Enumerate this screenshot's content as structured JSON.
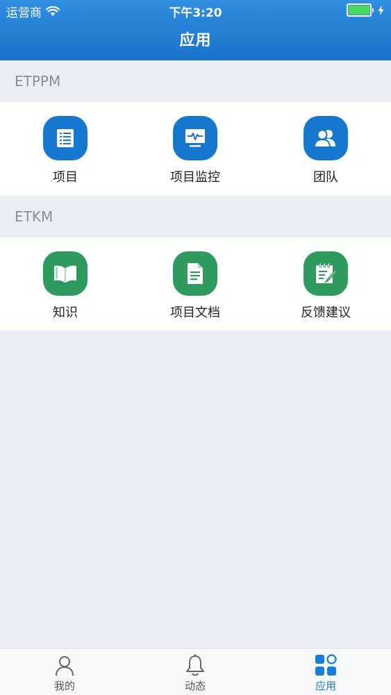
{
  "status_bar": {
    "carrier": "运营商",
    "time": "下午3:20"
  },
  "nav": {
    "title": "应用"
  },
  "sections": [
    {
      "label": "ETPPM",
      "apps": [
        {
          "label": "项目",
          "icon": "document-list-icon",
          "color": "#1677cf"
        },
        {
          "label": "项目监控",
          "icon": "monitor-pulse-icon",
          "color": "#1677cf"
        },
        {
          "label": "团队",
          "icon": "team-icon",
          "color": "#1677cf"
        }
      ]
    },
    {
      "label": "ETKM",
      "apps": [
        {
          "label": "知识",
          "icon": "open-book-icon",
          "color": "#2e9a5f"
        },
        {
          "label": "项目文档",
          "icon": "document-icon",
          "color": "#2e9a5f"
        },
        {
          "label": "反馈建议",
          "icon": "feedback-note-icon",
          "color": "#2e9a5f"
        }
      ]
    }
  ],
  "tabbar": {
    "items": [
      {
        "label": "我的",
        "icon": "person-icon",
        "active": false
      },
      {
        "label": "动态",
        "icon": "bell-icon",
        "active": false
      },
      {
        "label": "应用",
        "icon": "apps-grid-icon",
        "active": true
      }
    ],
    "active_color": "#1a7ed6"
  }
}
